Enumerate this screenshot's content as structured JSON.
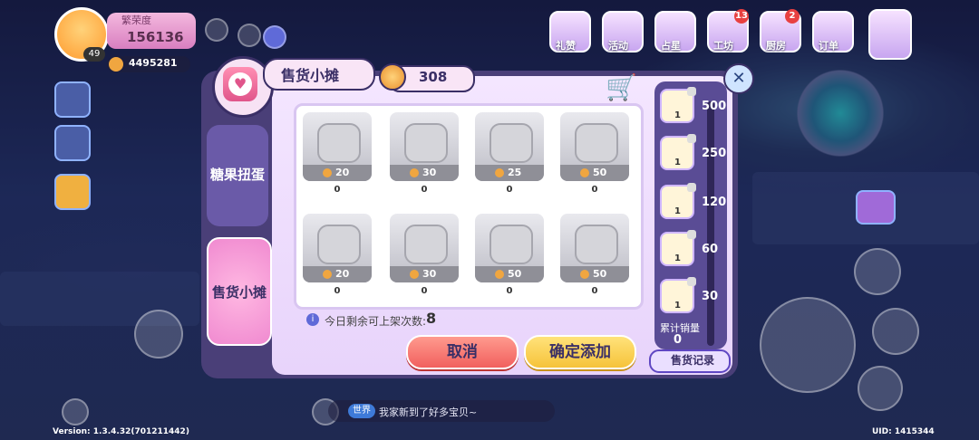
{
  "hud": {
    "avatar_level": "49",
    "fame_label": "繁荣度",
    "fame_value": "156136",
    "coins": "4495281",
    "top_buttons": [
      {
        "label": "礼赞",
        "badge": ""
      },
      {
        "label": "活动",
        "badge": ""
      },
      {
        "label": "占星",
        "badge": ""
      },
      {
        "label": "工坊",
        "badge": "13"
      },
      {
        "label": "厨房",
        "badge": "2"
      },
      {
        "label": "订单",
        "badge": ""
      }
    ]
  },
  "panel": {
    "title": "售货小摊",
    "currency": "308",
    "tabs": [
      {
        "label": "糖果扭蛋",
        "active": false
      },
      {
        "label": "售货小摊",
        "active": true
      }
    ],
    "items": [
      {
        "price": "20",
        "count": "0"
      },
      {
        "price": "30",
        "count": "0"
      },
      {
        "price": "25",
        "count": "0"
      },
      {
        "price": "50",
        "count": "0"
      },
      {
        "price": "20",
        "count": "0"
      },
      {
        "price": "30",
        "count": "0"
      },
      {
        "price": "50",
        "count": "0"
      },
      {
        "price": "50",
        "count": "0"
      }
    ],
    "info_text": "今日剩余可上架次数:",
    "info_count": "8",
    "cancel_label": "取消",
    "confirm_label": "确定添加",
    "rewards": [
      {
        "value": "500",
        "count": "1"
      },
      {
        "value": "250",
        "count": "1"
      },
      {
        "value": "120",
        "count": "1"
      },
      {
        "value": "60",
        "count": "1"
      },
      {
        "value": "30",
        "count": "1"
      }
    ],
    "cumulative_label": "累计销量",
    "cumulative_value": "0",
    "record_label": "售货记录"
  },
  "chat": {
    "channel": "世界",
    "message": "我家新到了好多宝贝~"
  },
  "footer": {
    "version": "Version: 1.3.4.32(701211442)",
    "uid": "UID: 1415344"
  }
}
